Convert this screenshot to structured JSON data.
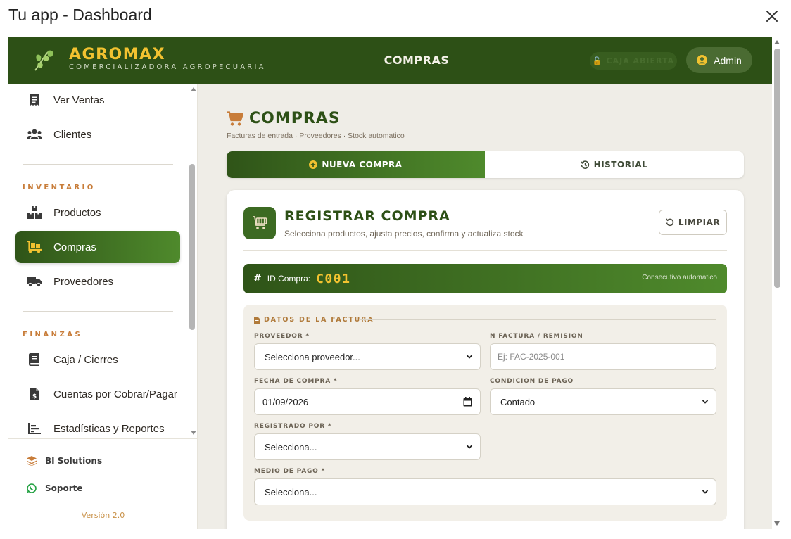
{
  "window": {
    "title": "Tu app - Dashboard"
  },
  "brand": {
    "name": "AGROMAX",
    "subtitle": "COMERCIALIZADORA AGROPECUARIA"
  },
  "header": {
    "title": "COMPRAS",
    "caja_badge": "CAJA ABIERTA",
    "user_label": "Admin"
  },
  "colors": {
    "primary": "#2d5016",
    "accent_gold": "#f2c230",
    "accent_orange": "#c87d3a",
    "background": "#efede7"
  },
  "sidebar": {
    "items_top": [
      {
        "label": "Ver Ventas",
        "icon": "receipt-icon"
      },
      {
        "label": "Clientes",
        "icon": "users-icon"
      }
    ],
    "section_inventario": "INVENTARIO",
    "items_inventario": [
      {
        "label": "Productos",
        "icon": "boxes-icon"
      },
      {
        "label": "Compras",
        "icon": "dolly-icon",
        "active": true
      },
      {
        "label": "Proveedores",
        "icon": "truck-icon"
      }
    ],
    "section_finanzas": "FINANZAS",
    "items_finanzas": [
      {
        "label": "Caja / Cierres",
        "icon": "book-icon"
      },
      {
        "label": "Cuentas por Cobrar/Pagar",
        "icon": "invoice-dollar-icon"
      },
      {
        "label": "Estadísticas y Reportes",
        "icon": "chart-bar-icon"
      }
    ],
    "footer": {
      "bi_label": "BI Solutions",
      "support_label": "Soporte",
      "version": "Versión 2.0"
    }
  },
  "page": {
    "title": "COMPRAS",
    "subtitle": "Facturas de entrada · Proveedores · Stock automatico",
    "tabs": [
      {
        "label": "NUEVA COMPRA",
        "active": true
      },
      {
        "label": "HISTORIAL",
        "active": false
      }
    ]
  },
  "form": {
    "title": "REGISTRAR COMPRA",
    "subtitle": "Selecciona productos, ajusta precios, confirma y actualiza stock",
    "clear_label": "LIMPIAR",
    "id_label": "ID Compra:",
    "id_value": "C001",
    "id_note": "Consecutivo automatico",
    "section_title": "DATOS DE LA FACTURA",
    "fields": {
      "proveedor": {
        "label": "PROVEEDOR *",
        "value": "Selecciona proveedor..."
      },
      "factura": {
        "label": "N FACTURA / REMISION",
        "placeholder": "Ej: FAC-2025-001"
      },
      "fecha": {
        "label": "FECHA DE COMPRA *",
        "value": "01/09/2026"
      },
      "condicion": {
        "label": "CONDICION DE PAGO",
        "value": "Contado"
      },
      "registrado": {
        "label": "REGISTRADO POR *",
        "value": "Selecciona..."
      },
      "medio": {
        "label": "MEDIO DE PAGO *",
        "value": "Selecciona..."
      }
    }
  }
}
